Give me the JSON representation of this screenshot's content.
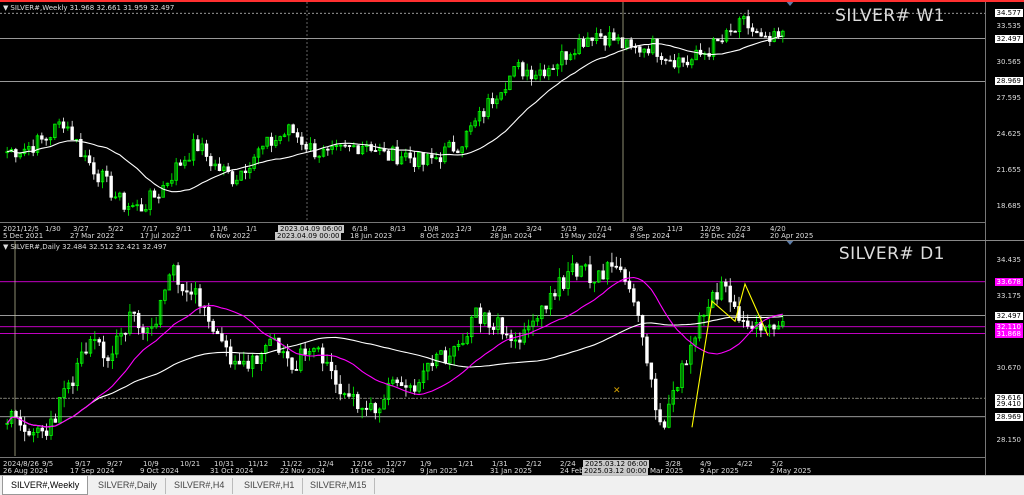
{
  "weekly_pane": {
    "header": "SILVER#,Weekly  31.968 32.661 31.959 32.497",
    "symbol_label": "SILVER# W1",
    "price_labels": [
      "33.535",
      "30.565",
      "27.595",
      "24.625",
      "21.655",
      "18.685"
    ],
    "tags": [
      {
        "text": "34.577",
        "style": "white",
        "price": 34.577
      },
      {
        "text": "32.497",
        "style": "white",
        "price": 32.497
      },
      {
        "text": "28.969",
        "style": "white",
        "price": 28.969
      }
    ],
    "hlines": [
      {
        "price": 34.577,
        "color": "#cccccc",
        "dash": "2,2"
      },
      {
        "price": 32.497,
        "color": "#cccccc",
        "dash": ""
      },
      {
        "price": 28.969,
        "color": "#cccccc",
        "dash": ""
      }
    ],
    "time_labels_top": [
      "2021/12/5",
      "1/30",
      "3/27",
      "5/22",
      "7/17",
      "9/11",
      "11/6",
      "1/1",
      "2023.04.09 06:00",
      "6/18",
      "8/13",
      "10/8",
      "12/3",
      "1/28",
      "3/24",
      "5/19",
      "7/14",
      "9/8",
      "11/3",
      "12/29",
      "2/23",
      "4/20"
    ],
    "time_labels_bottom": [
      "5 Dec 2021",
      "27 Mar 2022",
      "17 Jul 2022",
      "6 Nov 2022",
      "2023.04.09 00:00",
      "18 Jun 2023",
      "8 Oct 2023",
      "28 Jan 2024",
      "19 May 2024",
      "8 Sep 2024",
      "29 Dec 2024",
      "20 Apr 2025"
    ],
    "price_range": [
      17.4,
      35.5
    ]
  },
  "daily_pane": {
    "header": "SILVER#,Daily  32.484 32.512 32.421 32.497",
    "symbol_label": "SILVER# D1",
    "price_labels": [
      "34.435",
      "33.175",
      "30.670",
      "28.150"
    ],
    "tags": [
      {
        "text": "33.678",
        "style": "magenta",
        "price": 33.678
      },
      {
        "text": "32.497",
        "style": "white",
        "price": 32.497
      },
      {
        "text": "32.110",
        "style": "magenta",
        "price": 32.11
      },
      {
        "text": "31.868",
        "style": "magenta",
        "price": 31.868
      },
      {
        "text": "29.616",
        "style": "white",
        "price": 29.616
      },
      {
        "text": "29.410",
        "style": "white",
        "price": 29.41
      },
      {
        "text": "28.969",
        "style": "white",
        "price": 28.969
      }
    ],
    "hlines": [
      {
        "price": 33.678,
        "color": "#ff00ff",
        "dash": ""
      },
      {
        "price": 32.497,
        "color": "#cccccc",
        "dash": ""
      },
      {
        "price": 32.11,
        "color": "#ff00ff",
        "dash": ""
      },
      {
        "price": 31.868,
        "color": "#ff00ff",
        "dash": ""
      },
      {
        "price": 29.616,
        "color": "#cccccc",
        "dash": "2,2"
      },
      {
        "price": 28.969,
        "color": "#cccccc",
        "dash": ""
      }
    ],
    "time_labels_top": [
      "2024/8/26",
      "9/5",
      "9/17",
      "9/27",
      "10/9",
      "10/21",
      "10/31",
      "11/12",
      "11/22",
      "12/4",
      "12/16",
      "12/27",
      "1/9",
      "1/21",
      "1/31",
      "2/12",
      "2/24",
      "2025.03.12 06:00",
      "3/28",
      "4/9",
      "4/22",
      "5/2"
    ],
    "time_labels_bottom": [
      "26 Aug 2024",
      "17 Sep 2024",
      "9 Oct 2024",
      "31 Oct 2024",
      "22 Nov 2024",
      "16 Dec 2024",
      "9 Jan 2025",
      "31 Jan 2025",
      "24 Feb 2025",
      "2025.03.12 00:00",
      "Mar 2025",
      "9 Apr 2025",
      "2 May 2025"
    ],
    "price_range": [
      27.6,
      35.1
    ]
  },
  "tabs": [
    {
      "label": "SILVER#,Weekly",
      "active": true
    },
    {
      "label": "SILVER#,Daily",
      "active": false
    },
    {
      "label": "SILVER#,H4",
      "active": false
    },
    {
      "label": "SILVER#,H1",
      "active": false
    },
    {
      "label": "SILVER#,M15",
      "active": false
    }
  ],
  "colors": {
    "bull_candle": "#00ff00",
    "bear_candle": "#ffffff",
    "ma_white": "#ffffff",
    "ma_magenta": "#ff00ff",
    "annotation_yellow": "#ffff00",
    "crosshair": "#c8c8a0"
  },
  "icons": [
    "pane-collapse-triangle-icon",
    "chart-shift-marker-icon"
  ]
}
